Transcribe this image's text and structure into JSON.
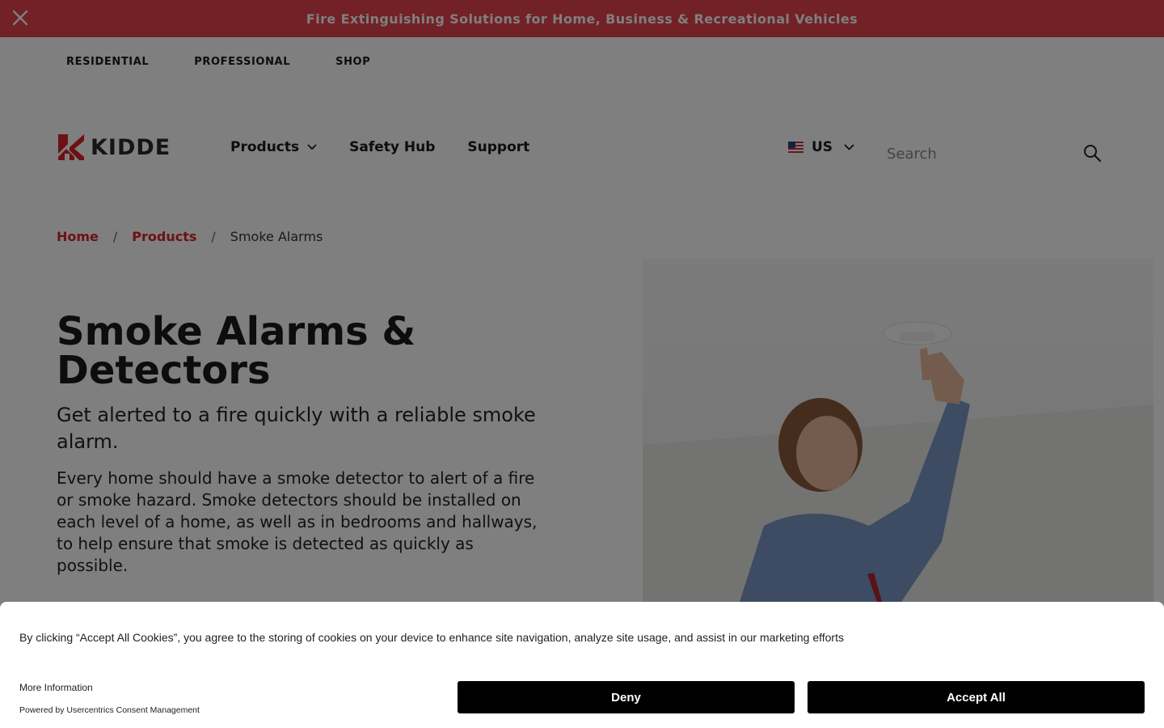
{
  "announcement": {
    "text": "Fire Extinguishing Solutions for Home, Business & Recreational Vehicles",
    "close_icon": "close-icon",
    "bg_color": "#e4434c"
  },
  "utility_nav": {
    "items": [
      "RESIDENTIAL",
      "PROFESSIONAL",
      "SHOP"
    ]
  },
  "header": {
    "logo_text": "KIDDE",
    "brand_color": "#d8232a",
    "nav": {
      "products": "Products",
      "safety_hub": "Safety Hub",
      "support": "Support"
    },
    "locale": "US",
    "search_placeholder": "Search"
  },
  "breadcrumb": {
    "home": "Home",
    "products": "Products",
    "current": "Smoke Alarms",
    "separator": "/"
  },
  "hero": {
    "title": "Smoke Alarms & Detectors",
    "subtitle": "Get alerted to a fire quickly with a reliable smoke alarm.",
    "body": "Every home should have a smoke detector to alert of a fire or smoke hazard. Smoke detectors should be installed on each level of a home, as well as in bedrooms and hallways, to help ensure that smoke is detected as quickly as possible."
  },
  "cookie_banner": {
    "message": "By clicking “Accept All Cookies”, you agree to the storing of cookies on your device to enhance site navigation, analyze site usage, and assist in our marketing efforts",
    "more_info": "More Information",
    "powered_by": "Powered by Usercentrics Consent Management",
    "deny_label": "Deny",
    "accept_label": "Accept All"
  }
}
